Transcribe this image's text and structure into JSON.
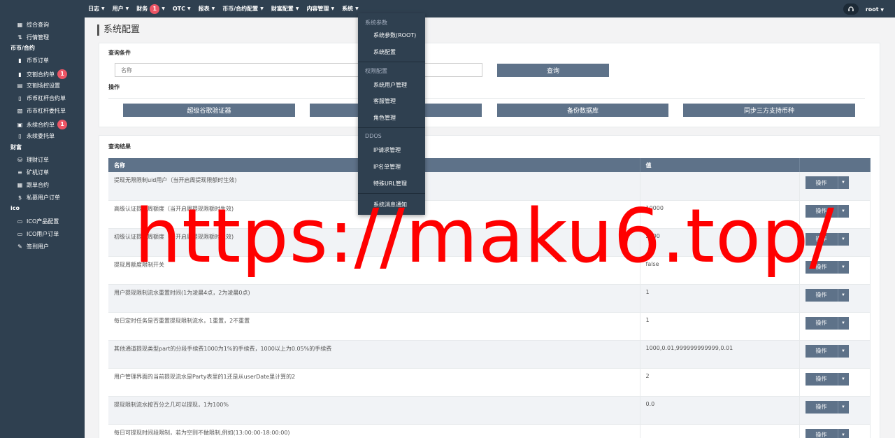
{
  "topnav": {
    "items": [
      {
        "label": "日志"
      },
      {
        "label": "用户"
      },
      {
        "label": "财务",
        "badge": "1"
      },
      {
        "label": "OTC"
      },
      {
        "label": "报表"
      },
      {
        "label": "币币/合约配置"
      },
      {
        "label": "财富配置"
      },
      {
        "label": "内容管理"
      },
      {
        "label": "系统"
      }
    ],
    "user": "root",
    "support_icon": "headset-icon"
  },
  "sidebar": {
    "items": [
      {
        "label": "综合查询",
        "icon": "dashboard-icon"
      },
      {
        "label": "行情管理",
        "icon": "sort-icon"
      }
    ],
    "groups": [
      {
        "title": "币币/合约",
        "items": [
          {
            "label": "币币订单",
            "icon": "bookmark-icon"
          },
          {
            "label": "交割合约单",
            "icon": "bookmark-icon",
            "badge": "1"
          },
          {
            "label": "交割场控设置",
            "icon": "calculator-icon"
          },
          {
            "label": "币币杠杆合约单",
            "icon": "file-icon"
          },
          {
            "label": "币币杠杆委托单",
            "icon": "edit-file-icon"
          },
          {
            "label": "永续合约单",
            "icon": "file-check-icon",
            "badge": "1"
          },
          {
            "label": "永续委托单",
            "icon": "file-icon"
          }
        ]
      },
      {
        "title": "财富",
        "items": [
          {
            "label": "理财订单",
            "icon": "database-icon"
          },
          {
            "label": "矿机订单",
            "icon": "bars-icon"
          },
          {
            "label": "跟单合约",
            "icon": "calendar-icon"
          },
          {
            "label": "私募用户订单",
            "icon": "dollar-icon"
          }
        ]
      },
      {
        "title": "ico",
        "items": [
          {
            "label": "ICO产品配置",
            "icon": "tag-icon"
          },
          {
            "label": "ICO用户订单",
            "icon": "monitor-icon"
          },
          {
            "label": "签到用户",
            "icon": "edit-icon"
          }
        ]
      }
    ]
  },
  "page": {
    "title": "系统配置"
  },
  "query": {
    "heading": "查询条件",
    "name_placeholder": "名称",
    "search_button": "查询",
    "ops_heading": "操作",
    "buttons": [
      "超级谷歌验证器",
      "备份数据库",
      "同步三方支持币种"
    ]
  },
  "results": {
    "heading": "查询结果",
    "columns": [
      "名称",
      "值",
      ""
    ],
    "op_label": "操作",
    "rows": [
      {
        "name": "提现无限限制uid用户（当开启周提现限额时生效)",
        "value": ""
      },
      {
        "name": "高级认证提现周额度（当开启周提现限额时生效)",
        "value": "10000"
      },
      {
        "name": "初级认证提现周额度（当开启周提现限额时生效)",
        "value": "2000"
      },
      {
        "name": "提现周额度限制开关",
        "value": "false"
      },
      {
        "name": "用户提现限制流水重置时间(1为凌晨4点，2为凌晨0点)",
        "value": "1"
      },
      {
        "name": "每日定时任务是否重置提现限制流水，1重置，2不重置",
        "value": "1"
      },
      {
        "name": "其他通道提现类型part的分段手续费1000为1%的手续费，1000以上为0.05%的手续费",
        "value": "1000,0.01,999999999999,0.01"
      },
      {
        "name": "用户管理界面的当前提现流水是Party表里的1还是从userDate里计算的2",
        "value": "2"
      },
      {
        "name": "提现限制流水按百分之几可以提现，1为100%",
        "value": "0.0"
      },
      {
        "name": "每日可提现时间段限制，若为空则不做限制,例如(13:00:00-18:00:00)",
        "value": ""
      }
    ]
  },
  "dropdown": {
    "sections": [
      {
        "header": "系统参数",
        "items": [
          "系统参数(ROOT)",
          "系统配置"
        ]
      },
      {
        "header": "权限配置",
        "items": [
          "系统用户管理",
          "客服管理",
          "角色管理"
        ]
      },
      {
        "header": "DDOS",
        "items": [
          "IP请求管理",
          "IP名单管理",
          "特殊URL管理"
        ]
      },
      {
        "header": "",
        "items": [
          "系统消息通知"
        ]
      }
    ]
  },
  "watermark": "https://maku6.top/",
  "colors": {
    "sidebar": "#2f4050",
    "button": "#5e7289",
    "badge": "#ed5565",
    "watermark": "#ff0000"
  }
}
